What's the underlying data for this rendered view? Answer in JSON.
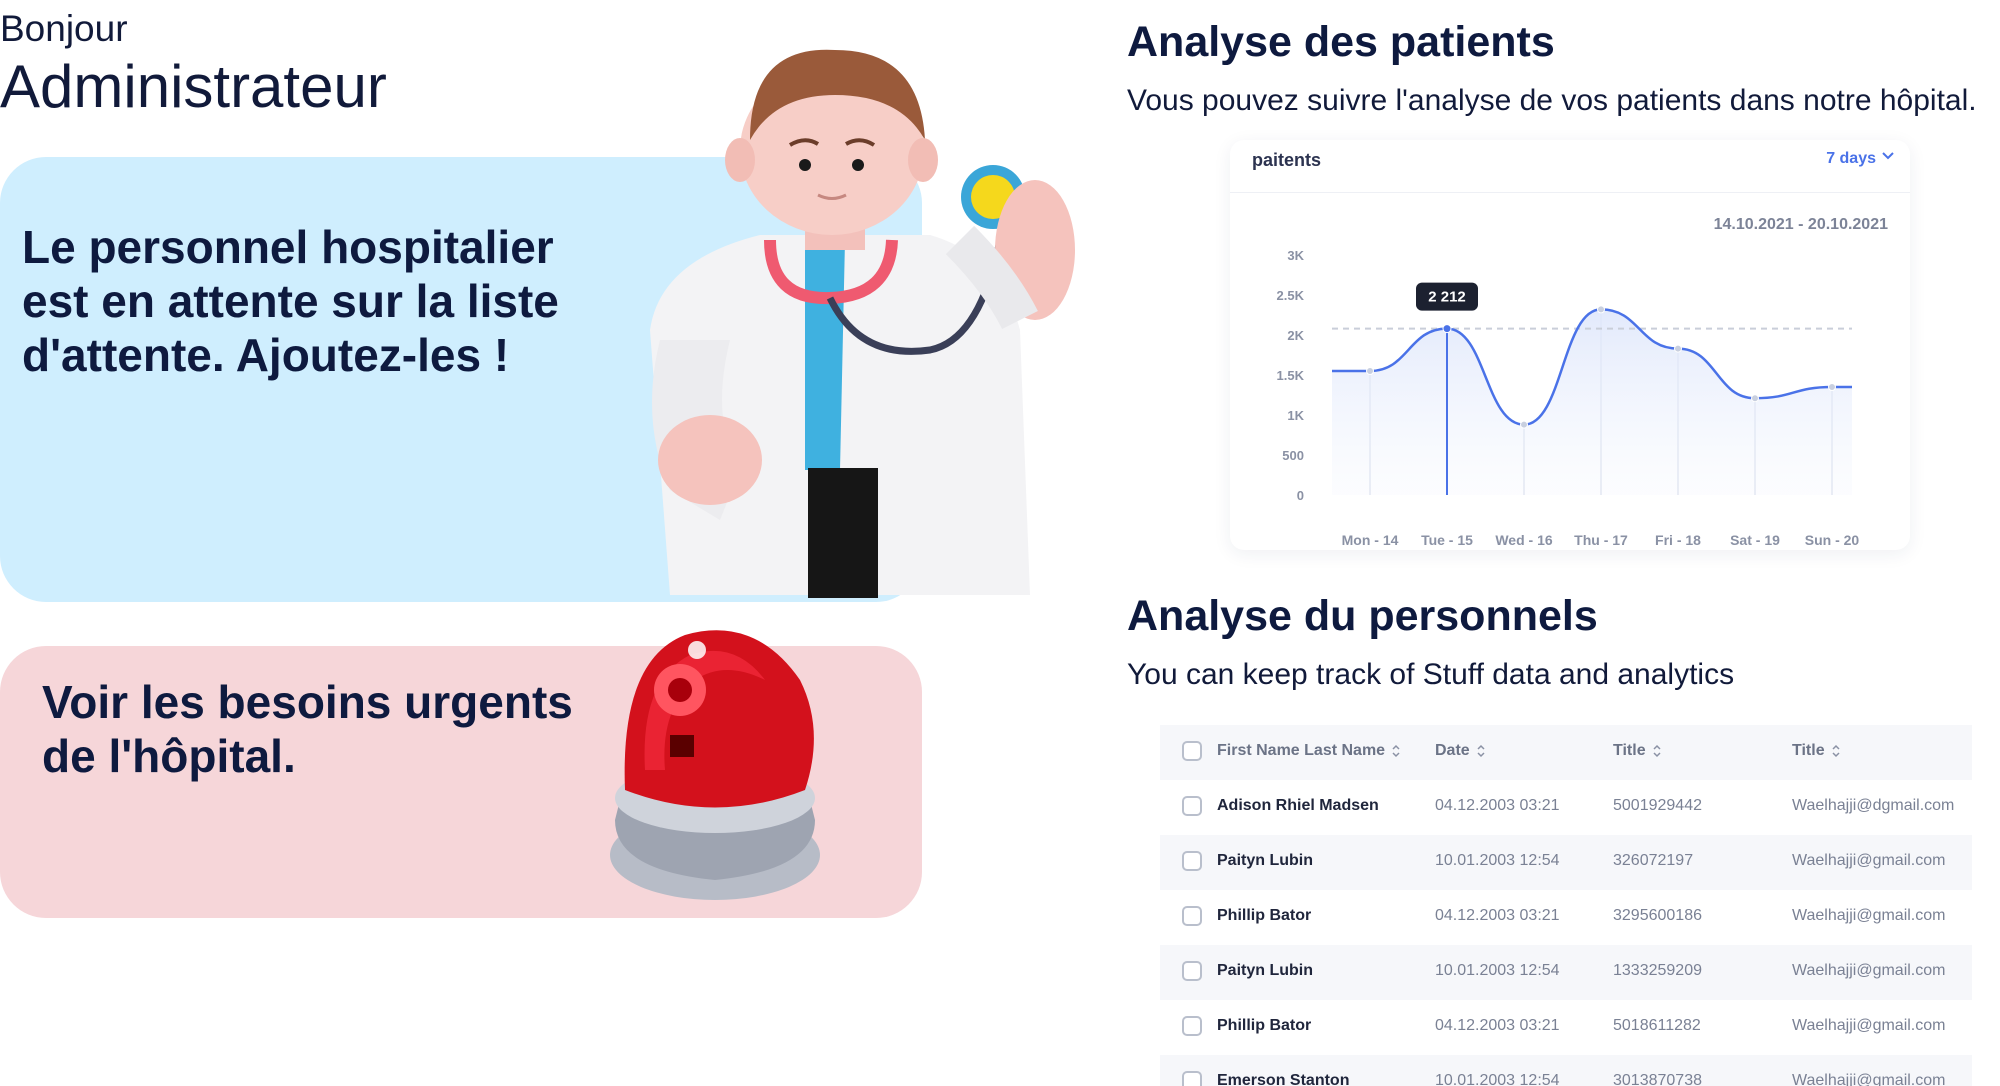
{
  "greeting": {
    "hello": "Bonjour",
    "role": "Administrateur"
  },
  "cards": {
    "staff_waiting": "Le personnel hospitalier est en attente sur la liste d'attente. Ajoutez-les !",
    "urgent_needs": "Voir les besoins urgents de l'hôpital."
  },
  "patients": {
    "title": "Analyse des patients",
    "subtitle": "Vous pouvez suivre l'analyse de vos patients dans notre hôpital."
  },
  "chart": {
    "header": "paitents",
    "range_select": "7 days",
    "date_range": "14.10.2021 - 20.10.2021",
    "tooltip_label": "2 212"
  },
  "chart_data": {
    "type": "line",
    "x": [
      "Mon - 14",
      "Tue - 15",
      "Wed - 16",
      "Thu - 17",
      "Fri - 18",
      "Sat - 19",
      "Sun - 20"
    ],
    "y_ticks": [
      "3K",
      "2.5K",
      "2K",
      "1.5K",
      "1K",
      "500",
      "0"
    ],
    "ylim": [
      0,
      3000
    ],
    "series": [
      {
        "values": [
          1550,
          2080,
          880,
          2320,
          1830,
          1210,
          1350
        ]
      }
    ],
    "reference_line": 2080,
    "highlight_index": 1,
    "color": "#4a72e8",
    "grid": false
  },
  "staff": {
    "title": "Analyse du personnels",
    "subtitle": "You can keep track of Stuff data and analytics"
  },
  "table": {
    "headers": [
      "First Name Last Name",
      "Date",
      "Title",
      "Title"
    ],
    "rows": [
      [
        "Adison Rhiel Madsen",
        "04.12.2003 03:21",
        "5001929442",
        "Waelhajji@dgmail.com"
      ],
      [
        "Paityn Lubin",
        "10.01.2003  12:54",
        "326072197",
        "Waelhajji@gmail.com"
      ],
      [
        "Phillip Bator",
        "04.12.2003 03:21",
        "3295600186",
        "Waelhajji@gmail.com"
      ],
      [
        "Paityn Lubin",
        "10.01.2003  12:54",
        "1333259209",
        "Waelhajji@gmail.com"
      ],
      [
        "Phillip Bator",
        "04.12.2003 03:21",
        "5018611282",
        "Waelhajji@gmail.com"
      ],
      [
        "Emerson Stanton",
        "10.01.2003  12:54",
        "3013870738",
        "Waelhajji@gmail.com"
      ]
    ]
  }
}
